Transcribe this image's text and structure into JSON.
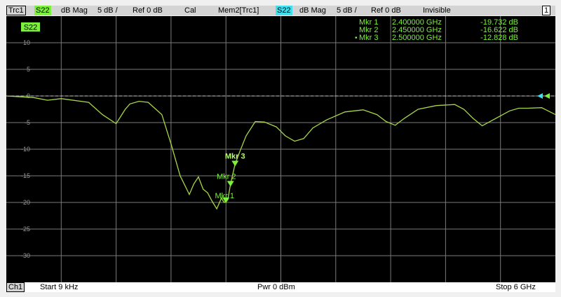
{
  "header": {
    "trace_name": "Trc1",
    "trace_param": "S22",
    "trace_format": "dB Mag",
    "trace_scale": "5 dB /",
    "trace_ref": "Ref 0 dB",
    "trace_cal": "Cal",
    "mem_name": "Mem2[Trc1]",
    "mem_param": "S22",
    "mem_format": "dB Mag",
    "mem_scale": "5 dB /",
    "mem_ref": "Ref 0 dB",
    "mem_status": "Invisible",
    "window_number": "1"
  },
  "plot": {
    "param_label": "S22",
    "y_ticks": [
      "10",
      "5",
      "0",
      "-5",
      "-10",
      "-15",
      "-20",
      "-25",
      "-30"
    ],
    "marker_table": [
      {
        "name": "Mkr 1",
        "freq": "2.400000 GHz",
        "value": "-19.732 dB",
        "active": false
      },
      {
        "name": "Mkr 2",
        "freq": "2.450000 GHz",
        "value": "-16.622 dB",
        "active": false
      },
      {
        "name": "Mkr 3",
        "freq": "2.500000 GHz",
        "value": "-12.828 dB",
        "active": true
      }
    ],
    "marker_labels": [
      "Mkr 1",
      "Mkr 2",
      "Mkr 3"
    ],
    "active_marker_symbol": "•"
  },
  "footer": {
    "channel": "Ch1",
    "start": "Start  9 kHz",
    "power": "Pwr  0 dBm",
    "stop": "Stop  6 GHz"
  },
  "chart_data": {
    "type": "line",
    "x_unit": "GHz",
    "y_unit": "dB",
    "xlim": [
      9e-06,
      6
    ],
    "ylim": [
      -35,
      15
    ],
    "grid": true,
    "reference_level": 0,
    "series": [
      {
        "color": "#a8d848",
        "x": [
          9e-06,
          0.3,
          0.45,
          0.6,
          0.9,
          1.05,
          1.2,
          1.3,
          1.35,
          1.45,
          1.55,
          1.7,
          1.8,
          1.9,
          2.0,
          2.05,
          2.1,
          2.15,
          2.2,
          2.25,
          2.3,
          2.35,
          2.38,
          2.42,
          2.45,
          2.5,
          2.55,
          2.62,
          2.72,
          2.82,
          2.95,
          3.05,
          3.15,
          3.25,
          3.35,
          3.5,
          3.7,
          3.9,
          4.05,
          4.15,
          4.25,
          4.35,
          4.5,
          4.7,
          4.9,
          5.0,
          5.1,
          5.2,
          5.35,
          5.5,
          5.6,
          5.7,
          5.85,
          6.0
        ],
        "y": [
          0,
          -0.3,
          -0.8,
          -0.5,
          -1.2,
          -3.5,
          -5.2,
          -2.5,
          -1.5,
          -1.0,
          -1.2,
          -3.5,
          -9.0,
          -15.0,
          -18.5,
          -16.5,
          -15.2,
          -17.5,
          -18.2,
          -19.8,
          -21.2,
          -19.2,
          -20.0,
          -19.5,
          -16.6,
          -12.8,
          -10.5,
          -7.5,
          -4.8,
          -4.9,
          -5.8,
          -7.5,
          -8.5,
          -8.0,
          -6.0,
          -4.5,
          -3.0,
          -2.6,
          -3.5,
          -4.8,
          -5.5,
          -4.2,
          -2.5,
          -1.8,
          -1.6,
          -2.5,
          -4.2,
          -5.6,
          -4.2,
          -2.8,
          -2.3,
          -2.3,
          -2.2,
          -3.5
        ]
      }
    ],
    "markers": [
      {
        "x": 2.4,
        "y": -19.732
      },
      {
        "x": 2.45,
        "y": -16.622
      },
      {
        "x": 2.5,
        "y": -12.828
      }
    ]
  }
}
